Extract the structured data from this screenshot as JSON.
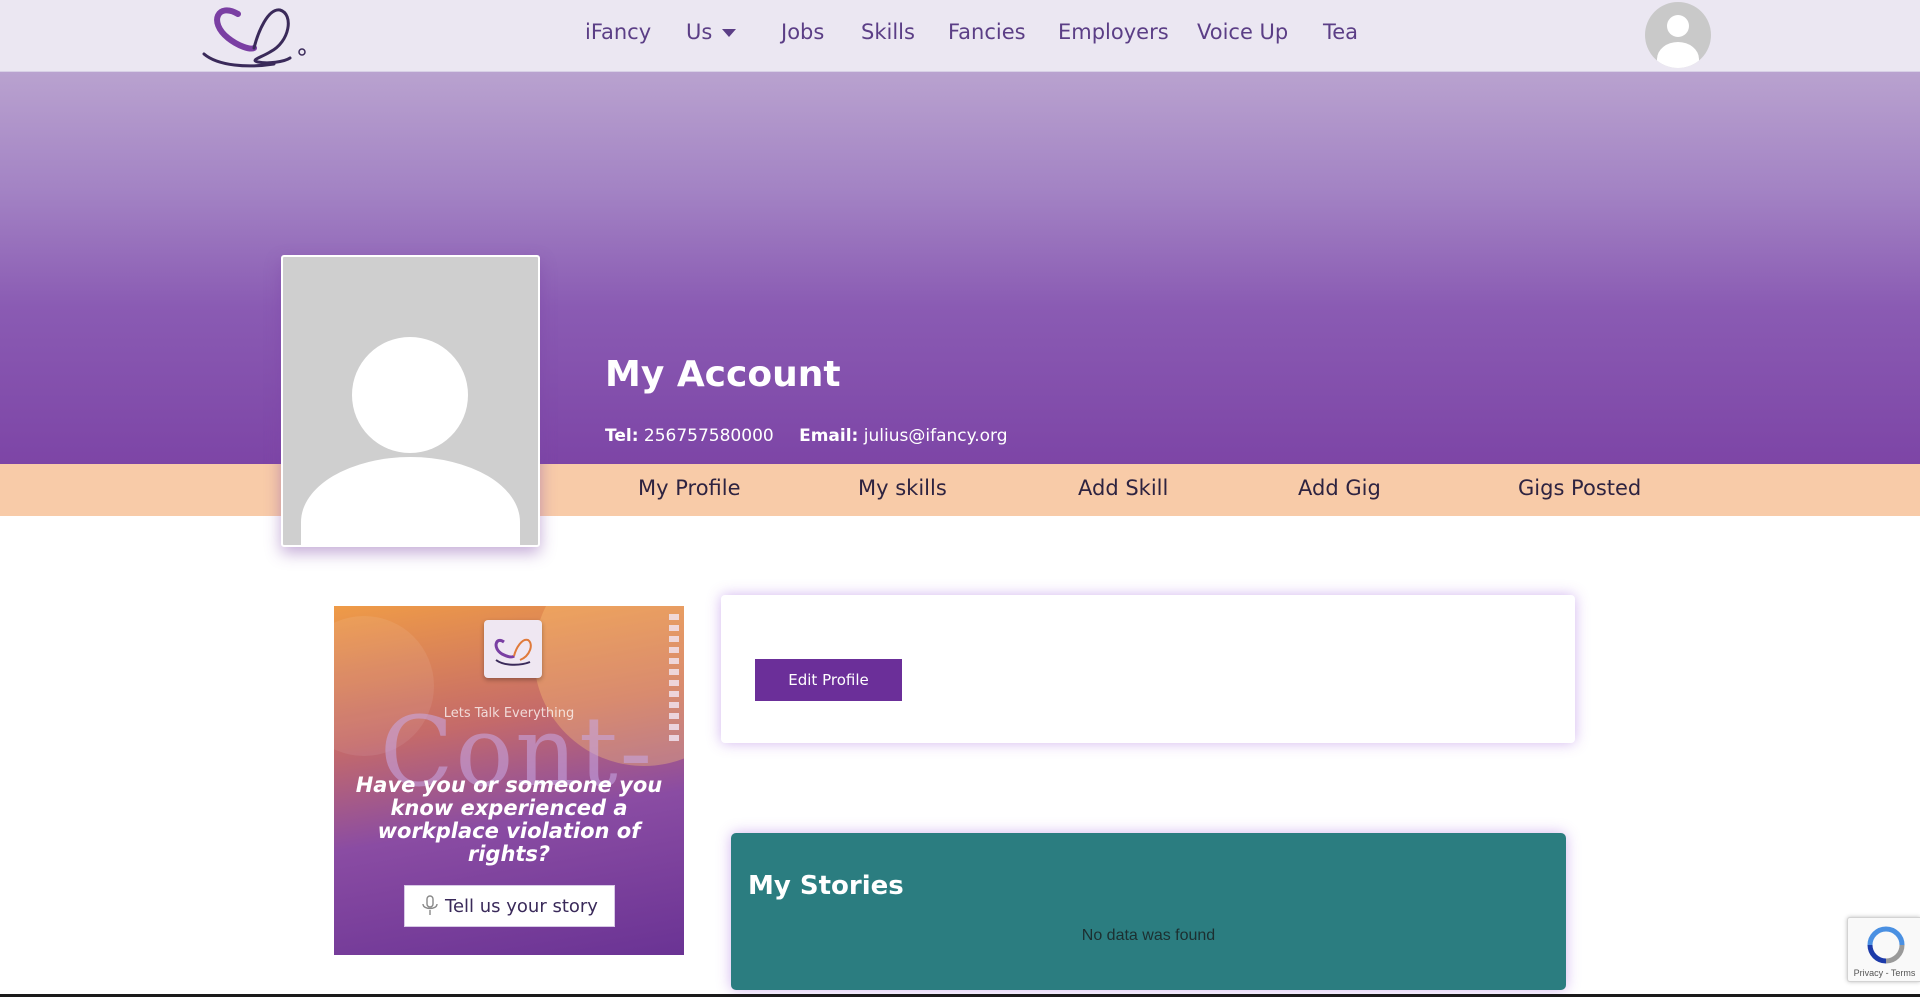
{
  "nav": {
    "logo": "ifancy-logo",
    "items": [
      "iFancy",
      "Us",
      "Jobs",
      "Skills",
      "Fancies",
      "Employers",
      "Voice Up",
      "Tea"
    ],
    "avatar": "user-avatar-icon"
  },
  "hero": {
    "title": "My Account",
    "tel_label": "Tel:",
    "tel_value": "256757580000",
    "email_label": "Email:",
    "email_value": "julius@ifancy.org"
  },
  "tabs": [
    "My Profile",
    "My skills",
    "Add Skill",
    "Add Gig",
    "Gigs Posted"
  ],
  "promo": {
    "eyebrow": "Lets Talk Everything",
    "big": "Cont-",
    "text": "Have you or someone you know experienced a workplace violation of rights?",
    "button": "Tell us your story"
  },
  "profile": {
    "edit_button": "Edit Profile"
  },
  "stories": {
    "title": "My Stories",
    "empty": "No data was found"
  },
  "recaptcha": {
    "footer": "Privacy - Terms"
  },
  "colors": {
    "brand_purple": "#6b2f99",
    "tab_strip": "#f8cba8",
    "stories_teal": "#2b7d80"
  }
}
